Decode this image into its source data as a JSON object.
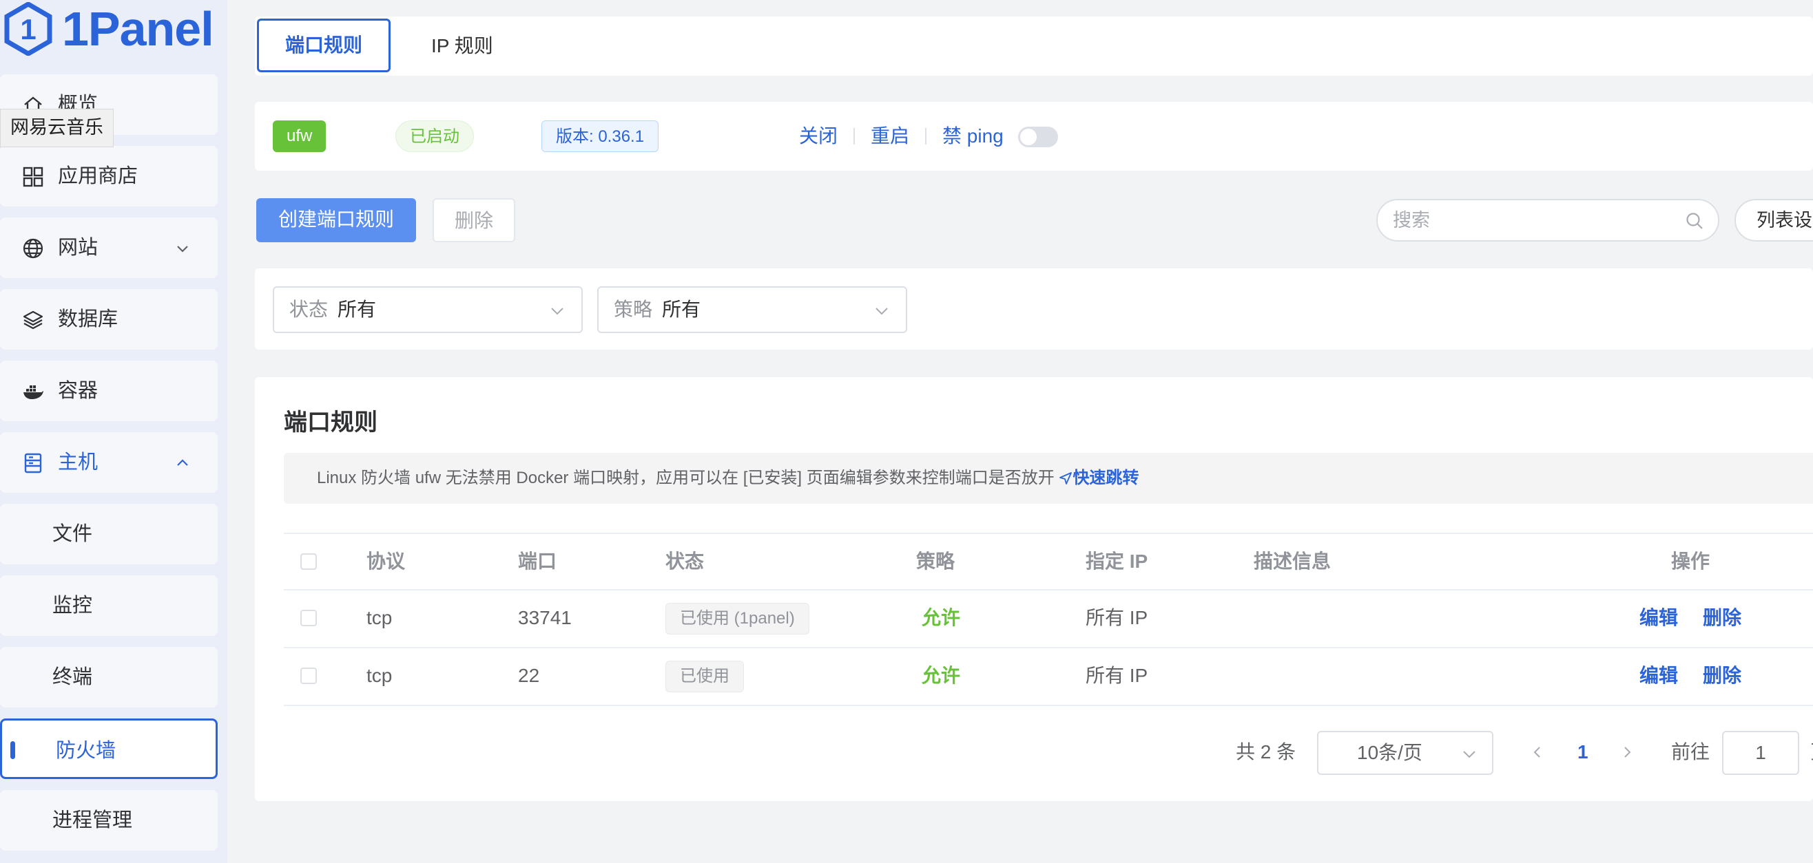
{
  "app": {
    "name": "1Panel"
  },
  "tooltip": "网易云音乐",
  "sidebar": {
    "items": [
      {
        "label": "概览"
      },
      {
        "label": "应用商店"
      },
      {
        "label": "网站"
      },
      {
        "label": "数据库"
      },
      {
        "label": "容器"
      },
      {
        "label": "主机"
      },
      {
        "label": "文件"
      },
      {
        "label": "监控"
      },
      {
        "label": "终端"
      },
      {
        "label": "防火墙"
      },
      {
        "label": "进程管理"
      }
    ]
  },
  "tabs": [
    {
      "label": "端口规则",
      "active": true
    },
    {
      "label": "IP 规则",
      "active": false
    }
  ],
  "status_bar": {
    "engine": "ufw",
    "state": "已启动",
    "version": "版本: 0.36.1",
    "stop": "关闭",
    "restart": "重启",
    "ping": "禁 ping",
    "ping_enabled": false
  },
  "toolbar": {
    "create": "创建端口规则",
    "delete": "删除",
    "search_placeholder": "搜索",
    "columns": "列表设置"
  },
  "filters": {
    "status": {
      "key": "状态",
      "value": "所有"
    },
    "strategy": {
      "key": "策略",
      "value": "所有"
    }
  },
  "section": {
    "title": "端口规则",
    "notice": "Linux 防火墙 ufw 无法禁用 Docker 端口映射，应用可以在 [已安装] 页面编辑参数来控制端口是否放开",
    "notice_link": "快速跳转"
  },
  "table": {
    "headers": {
      "protocol": "协议",
      "port": "端口",
      "status": "状态",
      "strategy": "策略",
      "ip": "指定 IP",
      "desc": "描述信息",
      "ops": "操作"
    },
    "rows": [
      {
        "protocol": "tcp",
        "port": "33741",
        "status": "已使用 (1panel)",
        "strategy": "允许",
        "ip": "所有 IP",
        "desc": "",
        "edit": "编辑",
        "delete": "删除"
      },
      {
        "protocol": "tcp",
        "port": "22",
        "status": "已使用",
        "strategy": "允许",
        "ip": "所有 IP",
        "desc": "",
        "edit": "编辑",
        "delete": "删除"
      }
    ]
  },
  "pagination": {
    "total": "共 2 条",
    "page_size": "10条/页",
    "current": "1",
    "goto_label": "前往",
    "goto_value": "1",
    "goto_suffix": "页"
  },
  "colors": {
    "accent": "#2b63d9",
    "success": "#67c23a",
    "primary_button": "#5b8ff0",
    "sidebar_bg": "#e9eef8"
  }
}
